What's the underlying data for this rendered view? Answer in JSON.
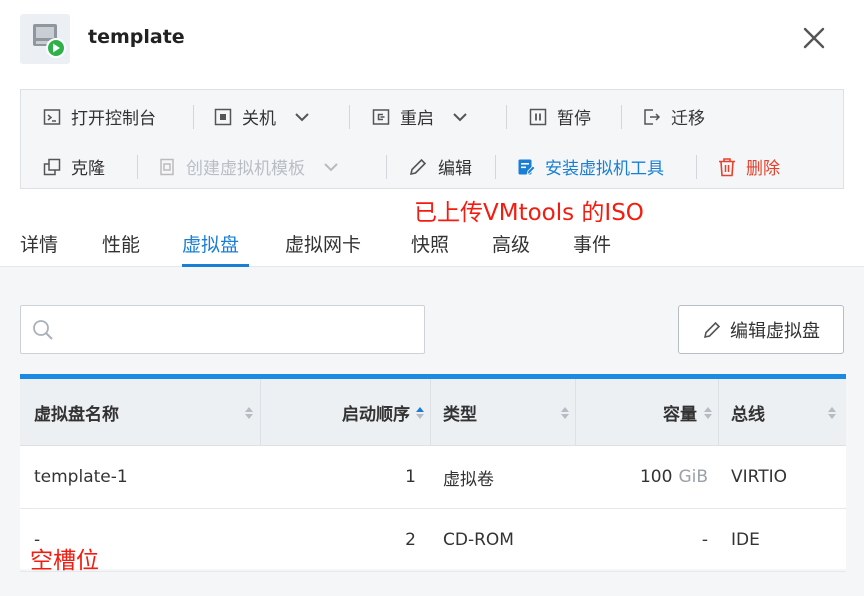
{
  "header": {
    "title": "template"
  },
  "toolbar": {
    "row1": [
      {
        "label": "打开控制台",
        "icon": "console-icon"
      },
      {
        "label": "关机",
        "icon": "stop-icon",
        "dropdown": true
      },
      {
        "label": "重启",
        "icon": "restart-icon",
        "dropdown": true
      },
      {
        "label": "暂停",
        "icon": "pause-icon"
      },
      {
        "label": "迁移",
        "icon": "migrate-icon"
      }
    ],
    "row2": [
      {
        "label": "克隆",
        "icon": "clone-icon"
      },
      {
        "label": "创建虚拟机模板",
        "icon": "template-icon",
        "dropdown": true,
        "disabled": true
      },
      {
        "label": "编辑",
        "icon": "pencil-icon"
      },
      {
        "label": "安装虚拟机工具",
        "icon": "install-tools-icon",
        "color": "#1a7fd4"
      },
      {
        "label": "删除",
        "icon": "trash-icon",
        "color": "#e5412d"
      }
    ]
  },
  "annotations": {
    "iso_note": "已上传VMtools 的ISO",
    "empty_slot_note": "空槽位"
  },
  "tabs": [
    "详情",
    "性能",
    "虚拟盘",
    "虚拟网卡",
    "快照",
    "高级",
    "事件"
  ],
  "active_tab": "虚拟盘",
  "search": {
    "placeholder": ""
  },
  "edit_disk_button": "编辑虚拟盘",
  "table": {
    "columns": [
      "虚拟盘名称",
      "启动顺序",
      "类型",
      "容量",
      "总线"
    ],
    "rows": [
      {
        "name": "template-1",
        "boot_order": "1",
        "type": "虚拟卷",
        "capacity": "100",
        "capacity_unit": "GiB",
        "bus": "VIRTIO"
      },
      {
        "name": "-",
        "boot_order": "2",
        "type": "CD-ROM",
        "capacity": "-",
        "capacity_unit": "",
        "bus": "IDE"
      }
    ]
  },
  "colors": {
    "accent": "#1a7fd4",
    "danger": "#e5412d",
    "annotation": "#f41b0f"
  }
}
